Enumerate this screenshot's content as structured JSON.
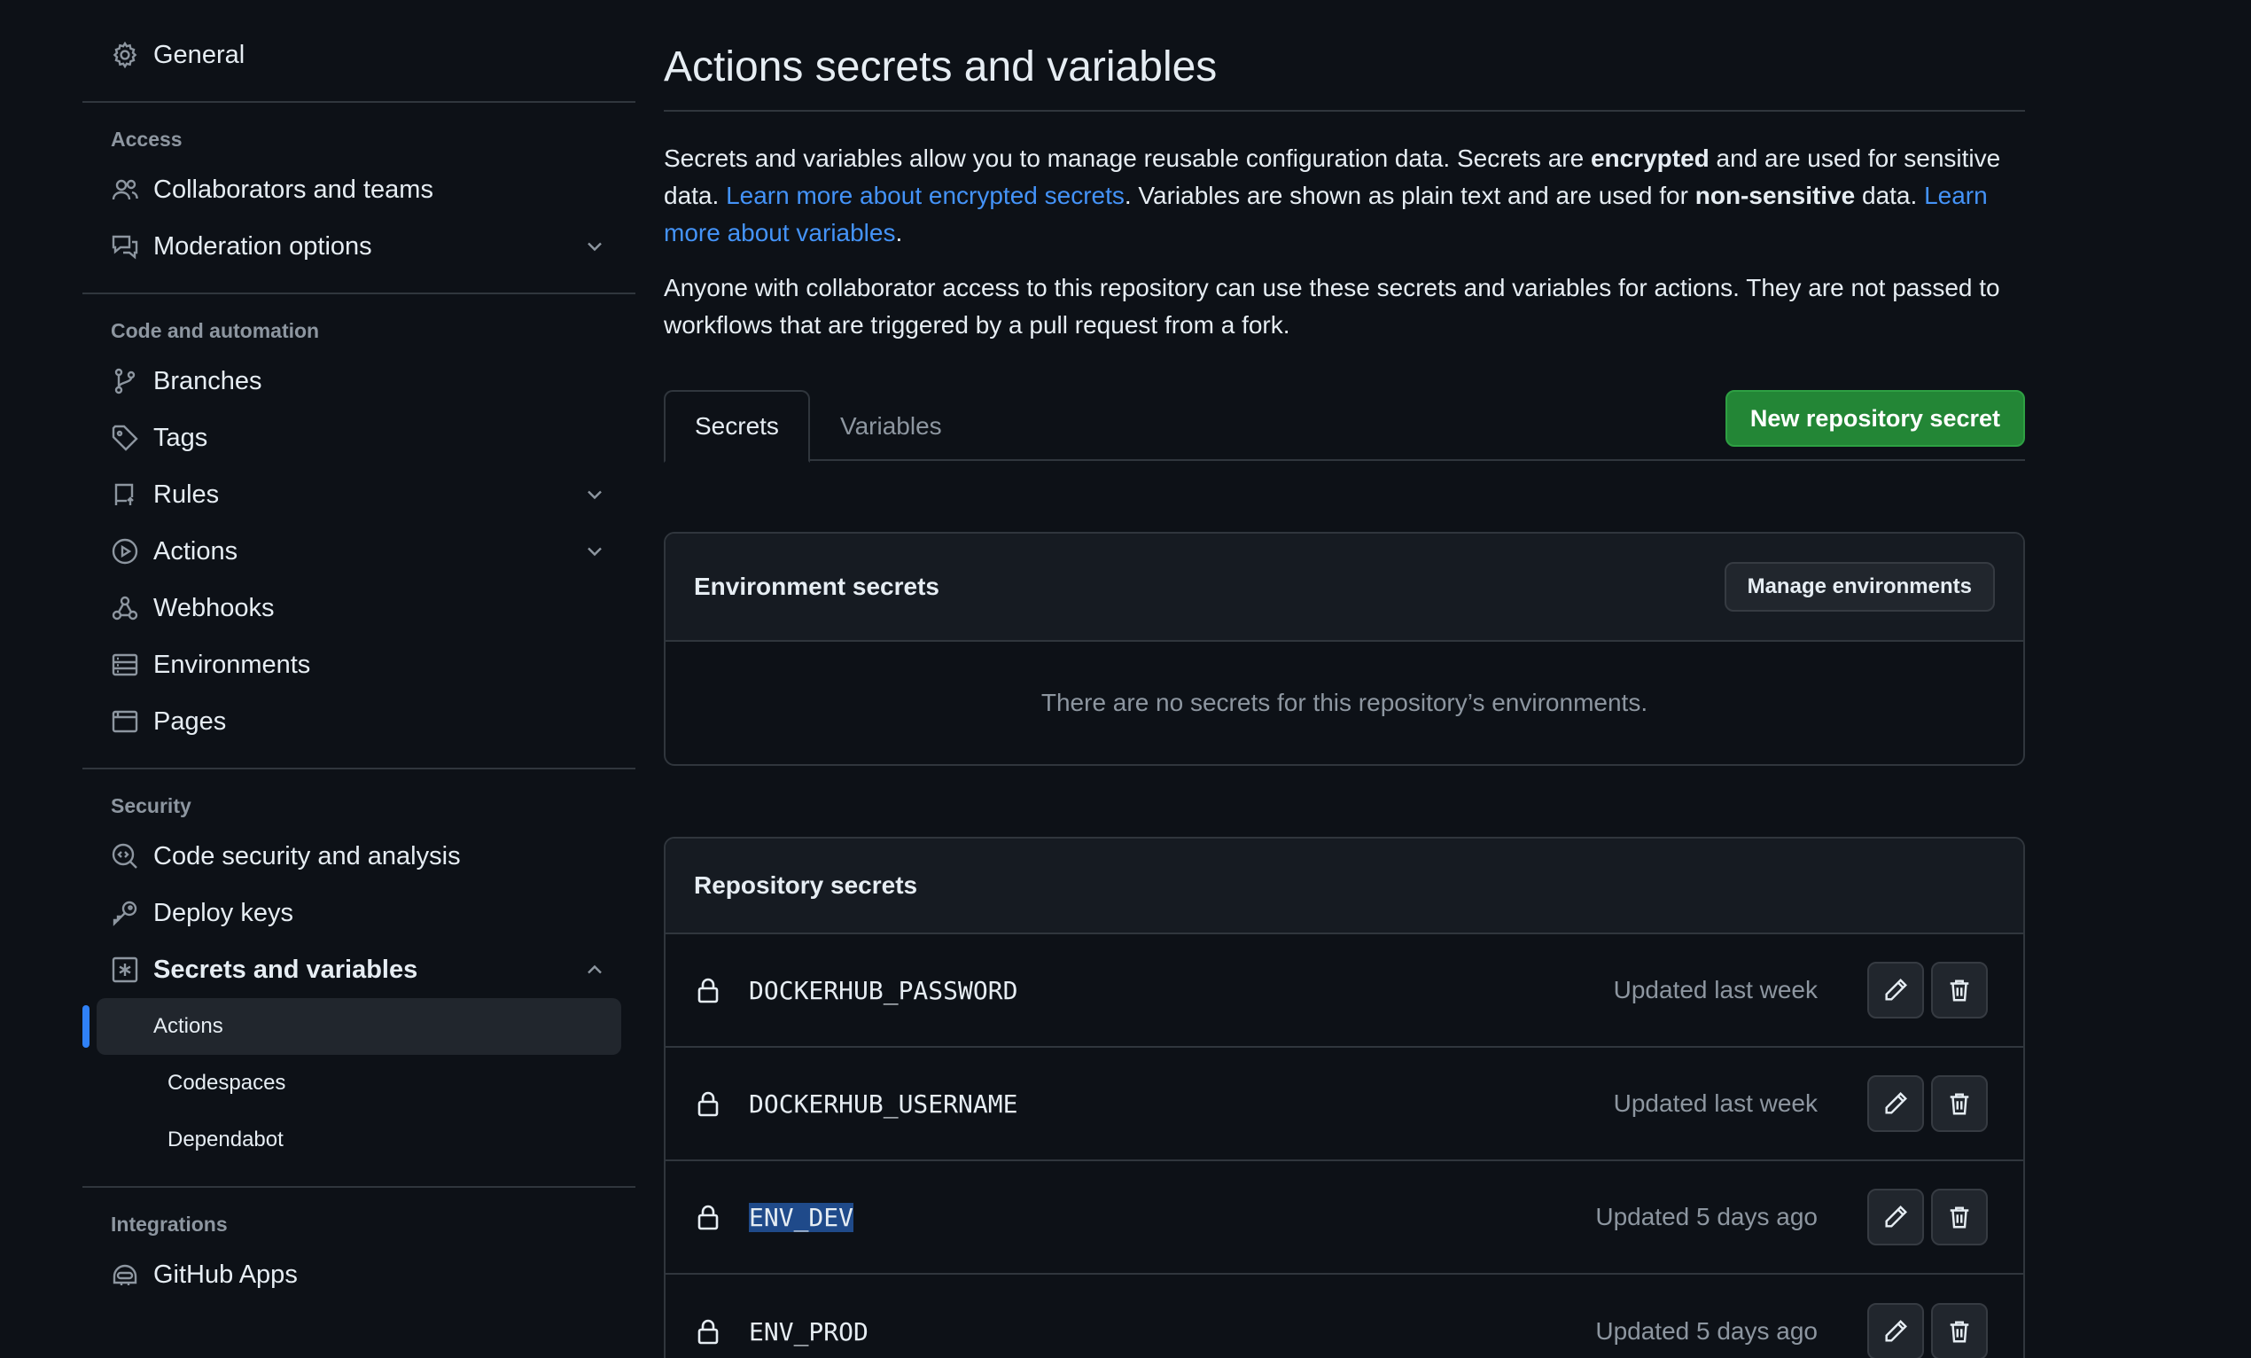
{
  "sidebar": {
    "general": "General",
    "sections": {
      "access": "Access",
      "code_automation": "Code and automation",
      "security": "Security",
      "integrations": "Integrations"
    },
    "access_items": [
      "Collaborators and teams",
      "Moderation options"
    ],
    "code_items": [
      "Branches",
      "Tags",
      "Rules",
      "Actions",
      "Webhooks",
      "Environments",
      "Pages"
    ],
    "security_items": [
      "Code security and analysis",
      "Deploy keys",
      "Secrets and variables"
    ],
    "secrets_sub_items": [
      "Actions",
      "Codespaces",
      "Dependabot"
    ],
    "integration_items": [
      "GitHub Apps"
    ]
  },
  "main": {
    "title": "Actions secrets and variables",
    "desc": {
      "p1_a": "Secrets and variables allow you to manage reusable configuration data. Secrets are ",
      "p1_b": "encrypted",
      "p1_c": " and are used for sensitive data. ",
      "p1_link1": "Learn more about encrypted secrets",
      "p1_d": ". Variables are shown as plain text and are used for ",
      "p1_e": "non-sensitive",
      "p1_f": " data. ",
      "p1_link2": "Learn more about variables",
      "p1_g": ".",
      "p2": "Anyone with collaborator access to this repository can use these secrets and variables for actions. They are not passed to workflows that are triggered by a pull request from a fork."
    },
    "tabs": {
      "secrets": "Secrets",
      "variables": "Variables"
    },
    "new_secret_button": "New repository secret",
    "env_secrets": {
      "title": "Environment secrets",
      "manage_button": "Manage environments",
      "empty": "There are no secrets for this repository’s environments."
    },
    "repo_secrets": {
      "title": "Repository secrets",
      "rows": [
        {
          "name": "DOCKERHUB_PASSWORD",
          "updated": "Updated last week"
        },
        {
          "name": "DOCKERHUB_USERNAME",
          "updated": "Updated last week"
        },
        {
          "name": "ENV_DEV",
          "updated": "Updated 5 days ago"
        },
        {
          "name": "ENV_PROD",
          "updated": "Updated 5 days ago"
        }
      ]
    }
  },
  "colors": {
    "background": "#0d1117",
    "primary_button": "#238636",
    "link": "#4493f8",
    "active_indicator": "#2f81f7"
  }
}
